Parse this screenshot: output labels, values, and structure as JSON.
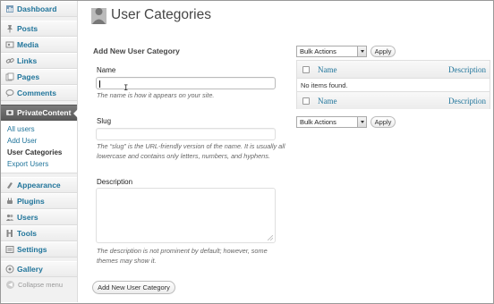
{
  "sidebar": {
    "items": [
      {
        "label": "Dashboard",
        "icon": "dashboard-icon"
      },
      {
        "label": "Posts",
        "icon": "pushpin-icon"
      },
      {
        "label": "Media",
        "icon": "media-icon"
      },
      {
        "label": "Links",
        "icon": "link-icon"
      },
      {
        "label": "Pages",
        "icon": "page-icon"
      },
      {
        "label": "Comments",
        "icon": "comment-icon"
      },
      {
        "label": "PrivateContent",
        "icon": "private-content-icon"
      }
    ],
    "submenu": [
      "All users",
      "Add User",
      "User Categories",
      "Export Users"
    ],
    "items2": [
      {
        "label": "Appearance",
        "icon": "appearance-icon"
      },
      {
        "label": "Plugins",
        "icon": "plugin-icon"
      },
      {
        "label": "Users",
        "icon": "users-icon"
      },
      {
        "label": "Tools",
        "icon": "tools-icon"
      },
      {
        "label": "Settings",
        "icon": "settings-icon"
      }
    ],
    "gallery": {
      "label": "Gallery",
      "icon": "gallery-icon"
    },
    "collapse": "Collapse menu"
  },
  "page": {
    "title": "User Categories"
  },
  "form": {
    "heading": "Add New User Category",
    "name_label": "Name",
    "name_value": "",
    "name_hint": "The name is how it appears on your site.",
    "slug_label": "Slug",
    "slug_value": "",
    "slug_hint_1": "The “slug” is the URL-friendly version of the name. It is usually all",
    "slug_hint_2": "lowercase and contains only letters, numbers, and hyphens.",
    "desc_label": "Description",
    "desc_value": "",
    "desc_hint_1": "The description is not prominent by default; however, some",
    "desc_hint_2": "themes may show it.",
    "submit": "Add New User Category"
  },
  "list": {
    "bulk_top": "Bulk Actions",
    "apply_top": "Apply",
    "col_name": "Name",
    "col_desc": "Description",
    "empty": "No items found.",
    "foot_name": "Name",
    "foot_desc": "Description",
    "bulk_bottom": "Bulk Actions",
    "apply_bottom": "Apply"
  },
  "colors": {
    "link": "#21759b",
    "current_menu": "#6a6a6a"
  }
}
